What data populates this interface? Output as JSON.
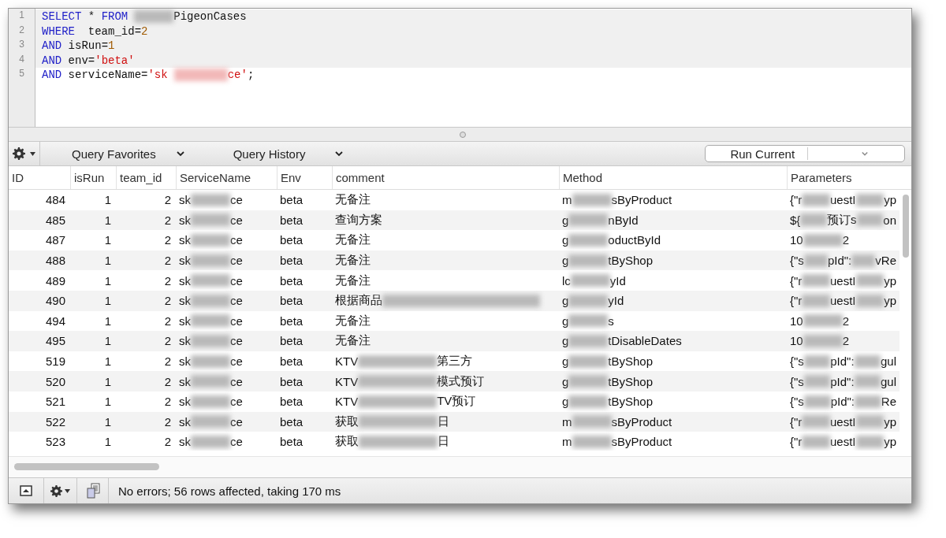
{
  "editor": {
    "lines": [
      {
        "number": "1",
        "highlighted": true,
        "tokens": [
          {
            "kind": "keyword",
            "text": "SELECT"
          },
          {
            "kind": "plain",
            "text": " * "
          },
          {
            "kind": "keyword",
            "text": "FROM"
          },
          {
            "kind": "blur"
          },
          {
            "kind": "plain",
            "text": "PigeonCases"
          }
        ]
      },
      {
        "number": "2",
        "highlighted": true,
        "tokens": [
          {
            "kind": "keyword",
            "text": "WHERE"
          },
          {
            "kind": "plain",
            "text": "  team_id="
          },
          {
            "kind": "number",
            "text": "2"
          }
        ]
      },
      {
        "number": "3",
        "highlighted": true,
        "tokens": [
          {
            "kind": "keyword",
            "text": "AND"
          },
          {
            "kind": "plain",
            "text": " isRun="
          },
          {
            "kind": "number",
            "text": "1"
          }
        ]
      },
      {
        "number": "4",
        "highlighted": true,
        "tokens": [
          {
            "kind": "keyword",
            "text": "AND"
          },
          {
            "kind": "plain",
            "text": " env="
          },
          {
            "kind": "string",
            "text": "'beta'"
          }
        ]
      },
      {
        "number": "5",
        "highlighted": false,
        "tokens": [
          {
            "kind": "keyword",
            "text": "AND"
          },
          {
            "kind": "plain",
            "text": " serviceName="
          },
          {
            "kind": "string",
            "text": "'sk"
          },
          {
            "kind": "blur-red"
          },
          {
            "kind": "string",
            "text": "ce'"
          },
          {
            "kind": "plain",
            "text": ";"
          }
        ]
      }
    ]
  },
  "toolbar": {
    "favorites": "Query Favorites",
    "history": "Query History",
    "run_button": "Run Current"
  },
  "table": {
    "columns": [
      {
        "label": "ID",
        "kind": "number"
      },
      {
        "label": "isRun",
        "kind": "number"
      },
      {
        "label": "team_id",
        "kind": "number"
      },
      {
        "label": "ServiceName",
        "kind": "text"
      },
      {
        "label": "Env",
        "kind": "text"
      },
      {
        "label": "comment",
        "kind": "text"
      },
      {
        "label": "Method",
        "kind": "text"
      },
      {
        "label": "Parameters",
        "kind": "text"
      }
    ],
    "rows": [
      [
        [
          "484"
        ],
        [
          "1"
        ],
        [
          "2"
        ],
        [
          "sk",
          {
            "kind": "blur"
          },
          "ce"
        ],
        [
          "beta"
        ],
        [
          "无备注"
        ],
        [
          "m",
          {
            "kind": "blur"
          },
          "sByProduct"
        ],
        [
          "{\"r",
          {
            "kind": "blur"
          },
          "uestI",
          {
            "kind": "blur"
          },
          "yp"
        ]
      ],
      [
        [
          "485"
        ],
        [
          "1"
        ],
        [
          "2"
        ],
        [
          "sk",
          {
            "kind": "blur"
          },
          "ce"
        ],
        [
          "beta"
        ],
        [
          "查询方案"
        ],
        [
          "g",
          {
            "kind": "blur"
          },
          "nById"
        ],
        [
          "${",
          {
            "kind": "blur"
          },
          "预订s",
          {
            "kind": "blur"
          },
          "on"
        ]
      ],
      [
        [
          "487"
        ],
        [
          "1"
        ],
        [
          "2"
        ],
        [
          "sk",
          {
            "kind": "blur"
          },
          "ce"
        ],
        [
          "beta"
        ],
        [
          "无备注"
        ],
        [
          "g",
          {
            "kind": "blur"
          },
          "oductById"
        ],
        [
          "10",
          {
            "kind": "blur"
          },
          "2"
        ]
      ],
      [
        [
          "488"
        ],
        [
          "1"
        ],
        [
          "2"
        ],
        [
          "sk",
          {
            "kind": "blur"
          },
          "ce"
        ],
        [
          "beta"
        ],
        [
          "无备注"
        ],
        [
          "g",
          {
            "kind": "blur"
          },
          "tByShop"
        ],
        [
          "{\"s",
          {
            "kind": "blur"
          },
          "pId\":",
          {
            "kind": "blur"
          },
          "vRe"
        ]
      ],
      [
        [
          "489"
        ],
        [
          "1"
        ],
        [
          "2"
        ],
        [
          "sk",
          {
            "kind": "blur"
          },
          "ce"
        ],
        [
          "beta"
        ],
        [
          "无备注"
        ],
        [
          "lc",
          {
            "kind": "blur"
          },
          "yId"
        ],
        [
          "{\"r",
          {
            "kind": "blur"
          },
          "uestI",
          {
            "kind": "blur"
          },
          "yp"
        ]
      ],
      [
        [
          "490"
        ],
        [
          "1"
        ],
        [
          "2"
        ],
        [
          "sk",
          {
            "kind": "blur"
          },
          "ce"
        ],
        [
          "beta"
        ],
        [
          "根据商品",
          {
            "kind": "blur-long"
          }
        ],
        [
          "g",
          {
            "kind": "blur"
          },
          "yId"
        ],
        [
          "{\"r",
          {
            "kind": "blur"
          },
          "uestI",
          {
            "kind": "blur"
          },
          "yp"
        ]
      ],
      [
        [
          "494"
        ],
        [
          "1"
        ],
        [
          "2"
        ],
        [
          "sk",
          {
            "kind": "blur"
          },
          "ce"
        ],
        [
          "beta"
        ],
        [
          "无备注"
        ],
        [
          "g",
          {
            "kind": "blur"
          },
          "s"
        ],
        [
          "10",
          {
            "kind": "blur"
          },
          "2"
        ]
      ],
      [
        [
          "495"
        ],
        [
          "1"
        ],
        [
          "2"
        ],
        [
          "sk",
          {
            "kind": "blur"
          },
          "ce"
        ],
        [
          "beta"
        ],
        [
          "无备注"
        ],
        [
          "g",
          {
            "kind": "blur"
          },
          "tDisableDates"
        ],
        [
          "10",
          {
            "kind": "blur"
          },
          "2"
        ]
      ],
      [
        [
          "519"
        ],
        [
          "1"
        ],
        [
          "2"
        ],
        [
          "sk",
          {
            "kind": "blur"
          },
          "ce"
        ],
        [
          "beta"
        ],
        [
          "KTV",
          {
            "kind": "blur-mid"
          },
          "第三方"
        ],
        [
          "g",
          {
            "kind": "blur"
          },
          "tByShop"
        ],
        [
          "{\"s",
          {
            "kind": "blur"
          },
          "pId\":",
          {
            "kind": "blur"
          },
          "gul"
        ]
      ],
      [
        [
          "520"
        ],
        [
          "1"
        ],
        [
          "2"
        ],
        [
          "sk",
          {
            "kind": "blur"
          },
          "ce"
        ],
        [
          "beta"
        ],
        [
          "KTV",
          {
            "kind": "blur-mid"
          },
          "模式预订"
        ],
        [
          "g",
          {
            "kind": "blur"
          },
          "tByShop"
        ],
        [
          "{\"s",
          {
            "kind": "blur"
          },
          "pId\":",
          {
            "kind": "blur"
          },
          "gul"
        ]
      ],
      [
        [
          "521"
        ],
        [
          "1"
        ],
        [
          "2"
        ],
        [
          "sk",
          {
            "kind": "blur"
          },
          "ce"
        ],
        [
          "beta"
        ],
        [
          "KTV",
          {
            "kind": "blur-mid"
          },
          "TV预订"
        ],
        [
          "g",
          {
            "kind": "blur"
          },
          "tByShop"
        ],
        [
          "{\"s",
          {
            "kind": "blur"
          },
          "pId\":",
          {
            "kind": "blur"
          },
          "Re"
        ]
      ],
      [
        [
          "522"
        ],
        [
          "1"
        ],
        [
          "2"
        ],
        [
          "sk",
          {
            "kind": "blur"
          },
          "ce"
        ],
        [
          "beta"
        ],
        [
          "获取",
          {
            "kind": "blur-mid"
          },
          "日"
        ],
        [
          "m",
          {
            "kind": "blur"
          },
          "sByProduct"
        ],
        [
          "{\"r",
          {
            "kind": "blur"
          },
          "uestI",
          {
            "kind": "blur"
          },
          "yp"
        ]
      ],
      [
        [
          "523"
        ],
        [
          "1"
        ],
        [
          "2"
        ],
        [
          "sk",
          {
            "kind": "blur"
          },
          "ce"
        ],
        [
          "beta"
        ],
        [
          "获取",
          {
            "kind": "blur-mid"
          },
          "日"
        ],
        [
          "m",
          {
            "kind": "blur"
          },
          "sByProduct"
        ],
        [
          "{\"r",
          {
            "kind": "blur"
          },
          "uestI",
          {
            "kind": "blur"
          },
          "yp"
        ]
      ]
    ]
  },
  "status_bar": {
    "message": "No errors; 56 rows affected, taking 170 ms"
  }
}
